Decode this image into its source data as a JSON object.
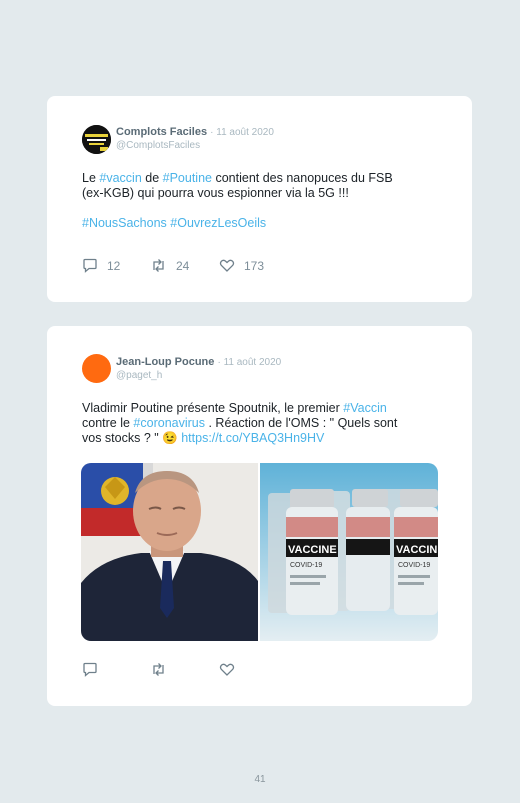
{
  "tweets": [
    {
      "author": "Complots Faciles",
      "date": "· 11 août 2020",
      "handle": "@ComplotsFaciles",
      "line1": [
        "Le ",
        "#vaccin",
        " de ",
        "#Poutine",
        " contient des nanopuces du FSB"
      ],
      "line2": "(ex-KGB) qui pourra vous espionner via la 5G !!!",
      "hashtags": [
        "#NousSachons",
        "#OuvrezLesOeils"
      ],
      "replies": "12",
      "retweets": "24",
      "likes": "173"
    },
    {
      "author": "Jean-Loup Pocune",
      "date": "· 11 août 2020",
      "handle": "@paget_h",
      "line1": [
        "Vladimir Poutine présente Spoutnik, le premier ",
        "#Vaccin"
      ],
      "line2": [
        "contre le ",
        "#coronavirus",
        " . Réaction de l'OMS : \" Quels sont"
      ],
      "line3": [
        "vos stocks ? \" ",
        "😉",
        " ",
        "https://t.co/YBAQ3Hn9HV"
      ],
      "vaccine_label": "VACCINE",
      "vaccine_sub": "COVID-19"
    }
  ],
  "colors": {
    "accent": "#4ab3e8",
    "background": "#e3eaed",
    "name": "#5a6b76"
  },
  "icons": [
    "reply-icon",
    "retweet-icon",
    "like-icon"
  ],
  "page_number": "41"
}
